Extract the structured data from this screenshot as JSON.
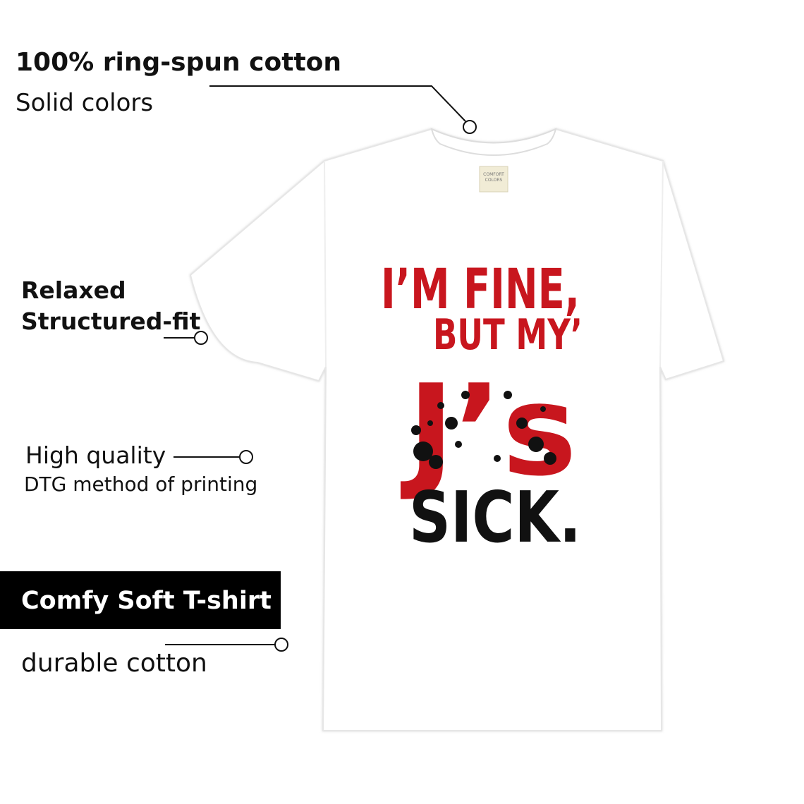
{
  "features": {
    "cotton_title": "100% ring-spun cotton",
    "cotton_sub": "Solid colors",
    "fit_title_1": "Relaxed",
    "fit_title_2": "Structured-fit",
    "quality_1": "High quality",
    "quality_2": "DTG method of printing",
    "badge": "Comfy Soft T-shirt",
    "durable": "durable cotton"
  },
  "shirt": {
    "color": "#ffffff",
    "tag_brand_1": "COMFORT",
    "tag_brand_2": "COLORS",
    "print_line1": "I’M FINE,",
    "print_line2": "BUT MY’",
    "print_line3": "J’s",
    "print_line4": "SICK.",
    "print_red": "#c8161e",
    "print_black": "#111111"
  }
}
